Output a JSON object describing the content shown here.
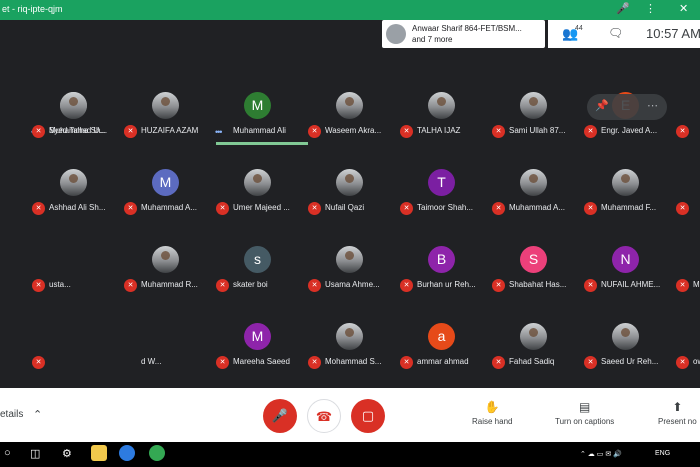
{
  "share_bar": {
    "title": "et - riq-ipte-qjm",
    "mic_icon": "microphone-icon",
    "more_icon": "more-vertical-icon",
    "close_icon": "close-icon"
  },
  "notification": {
    "line1": "Anwaar Sharif 864-FET/BSM...",
    "line2": "and 7 more"
  },
  "top_right": {
    "participant_count": "44",
    "time": "10:57 AM"
  },
  "participants": [
    {
      "name": "Muhammad U...",
      "avatar": "photo",
      "status": "speaking-dots"
    },
    {
      "name": "HUZAIFA AZAM",
      "avatar": "photo",
      "status": "muted"
    },
    {
      "name": "Muhammad Ali",
      "avatar": "M",
      "color": "#2e7d32",
      "status": "speaking-dots",
      "active": true
    },
    {
      "name": "Waseem Akra...",
      "avatar": "photo",
      "status": "muted"
    },
    {
      "name": "TALHA IJAZ",
      "avatar": "photo",
      "status": "muted"
    },
    {
      "name": "Sami Ullah 87...",
      "avatar": "photo",
      "status": "muted"
    },
    {
      "name": "Engr. Javed A...",
      "avatar": "E",
      "color": "#e64a19",
      "status": "muted"
    },
    {
      "name": "",
      "avatar": "none",
      "status": "muted"
    },
    {
      "name": "Ashhad Ali Sh...",
      "avatar": "photo",
      "status": "muted"
    },
    {
      "name": "Muhammad A...",
      "avatar": "M",
      "color": "#5c6bc0",
      "status": "muted"
    },
    {
      "name": "Umer Majeed ...",
      "avatar": "photo",
      "status": "muted"
    },
    {
      "name": "Nufail Qazi",
      "avatar": "photo",
      "status": "muted"
    },
    {
      "name": "Taimoor Shah...",
      "avatar": "T",
      "color": "#7b1fa2",
      "status": "muted"
    },
    {
      "name": "Muhammad A...",
      "avatar": "photo",
      "status": "muted"
    },
    {
      "name": "Muhammad F...",
      "avatar": "photo",
      "status": "muted"
    },
    {
      "name": "",
      "avatar": "none",
      "status": "muted"
    },
    {
      "name": "usta...",
      "avatar": "none",
      "status": "muted"
    },
    {
      "name": "Muhammad R...",
      "avatar": "photo",
      "status": "muted"
    },
    {
      "name": "skater boi",
      "avatar": "s",
      "color": "#455a64",
      "status": "muted"
    },
    {
      "name": "Usama Ahme...",
      "avatar": "photo",
      "status": "muted"
    },
    {
      "name": "Burhan ur Reh...",
      "avatar": "B",
      "color": "#8e24aa",
      "status": "muted"
    },
    {
      "name": "Shabahat Has...",
      "avatar": "S",
      "color": "#ec407a",
      "status": "muted"
    },
    {
      "name": "NUFAIL AHME...",
      "avatar": "N",
      "color": "#8e24aa",
      "status": "muted"
    },
    {
      "name": "Muhammad A...",
      "avatar": "photo",
      "status": "muted"
    },
    {
      "name": "",
      "avatar": "none",
      "status": "muted"
    },
    {
      "name": "d W...",
      "avatar": "none",
      "status": "none"
    },
    {
      "name": "Mareeha Saeed",
      "avatar": "M",
      "color": "#8e24aa",
      "status": "muted"
    },
    {
      "name": "Mohammad S...",
      "avatar": "photo",
      "status": "muted"
    },
    {
      "name": "ammar ahmad",
      "avatar": "a",
      "color": "#e64a19",
      "status": "muted"
    },
    {
      "name": "Fahad Sadiq",
      "avatar": "photo",
      "status": "muted"
    },
    {
      "name": "Saeed Ur Reh...",
      "avatar": "photo",
      "status": "muted"
    },
    {
      "name": "owais rasheed",
      "avatar": "o",
      "color": "#7cb342",
      "status": "muted"
    },
    {
      "name": "Syed Talha Sh...",
      "avatar": "photo",
      "status": "muted"
    },
    {
      "name": "",
      "avatar": "none",
      "status": "muted"
    }
  ],
  "controls": {
    "details_label": "etails",
    "mic_icon": "mic-off-icon",
    "hangup_icon": "call-end-icon",
    "camera_icon": "videocam-off-icon",
    "raise_hand": "Raise hand",
    "captions": "Turn on captions",
    "present": "Present no"
  },
  "taskbar": {
    "lang": "ENG"
  }
}
